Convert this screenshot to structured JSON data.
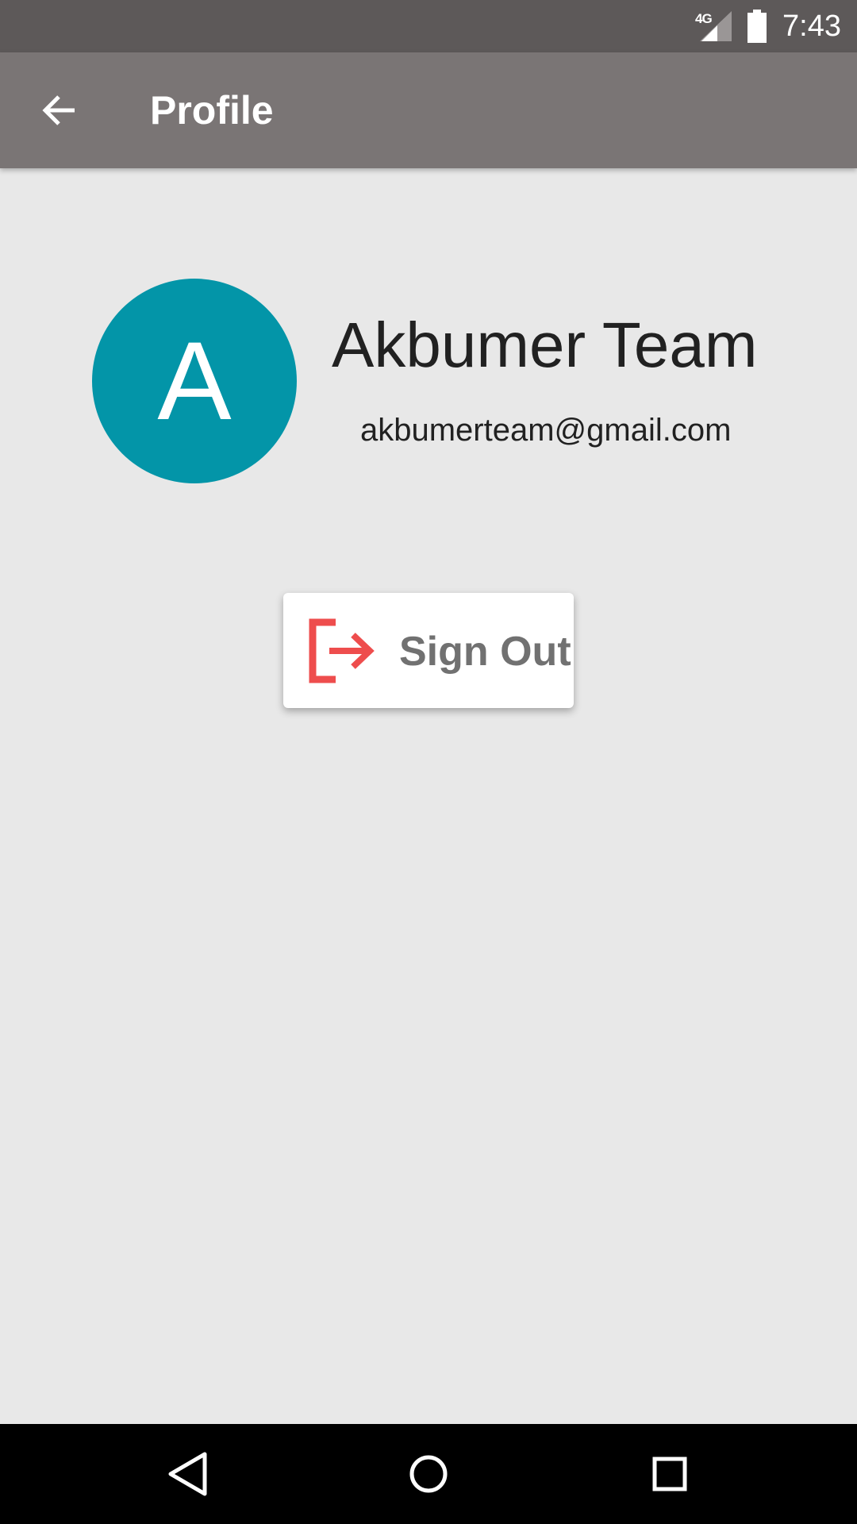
{
  "status_bar": {
    "network_type": "4G",
    "time": "7:43",
    "icons": [
      "cellular-signal-icon",
      "battery-icon"
    ]
  },
  "app_bar": {
    "title": "Profile",
    "back_icon": "arrow-back-icon"
  },
  "profile": {
    "avatar_initial": "A",
    "avatar_color": "#0395a8",
    "name": "Akbumer Team",
    "email": "akbumerteam@gmail.com"
  },
  "actions": {
    "sign_out_label": "Sign Out",
    "sign_out_icon": "logout-icon",
    "sign_out_icon_color": "#ee4d4d"
  },
  "nav_bar": {
    "icons": [
      "nav-back-icon",
      "nav-home-icon",
      "nav-recents-icon"
    ]
  },
  "colors": {
    "status_bar": "#5d5959",
    "app_bar": "#7a7575",
    "background": "#e8e8e8"
  }
}
